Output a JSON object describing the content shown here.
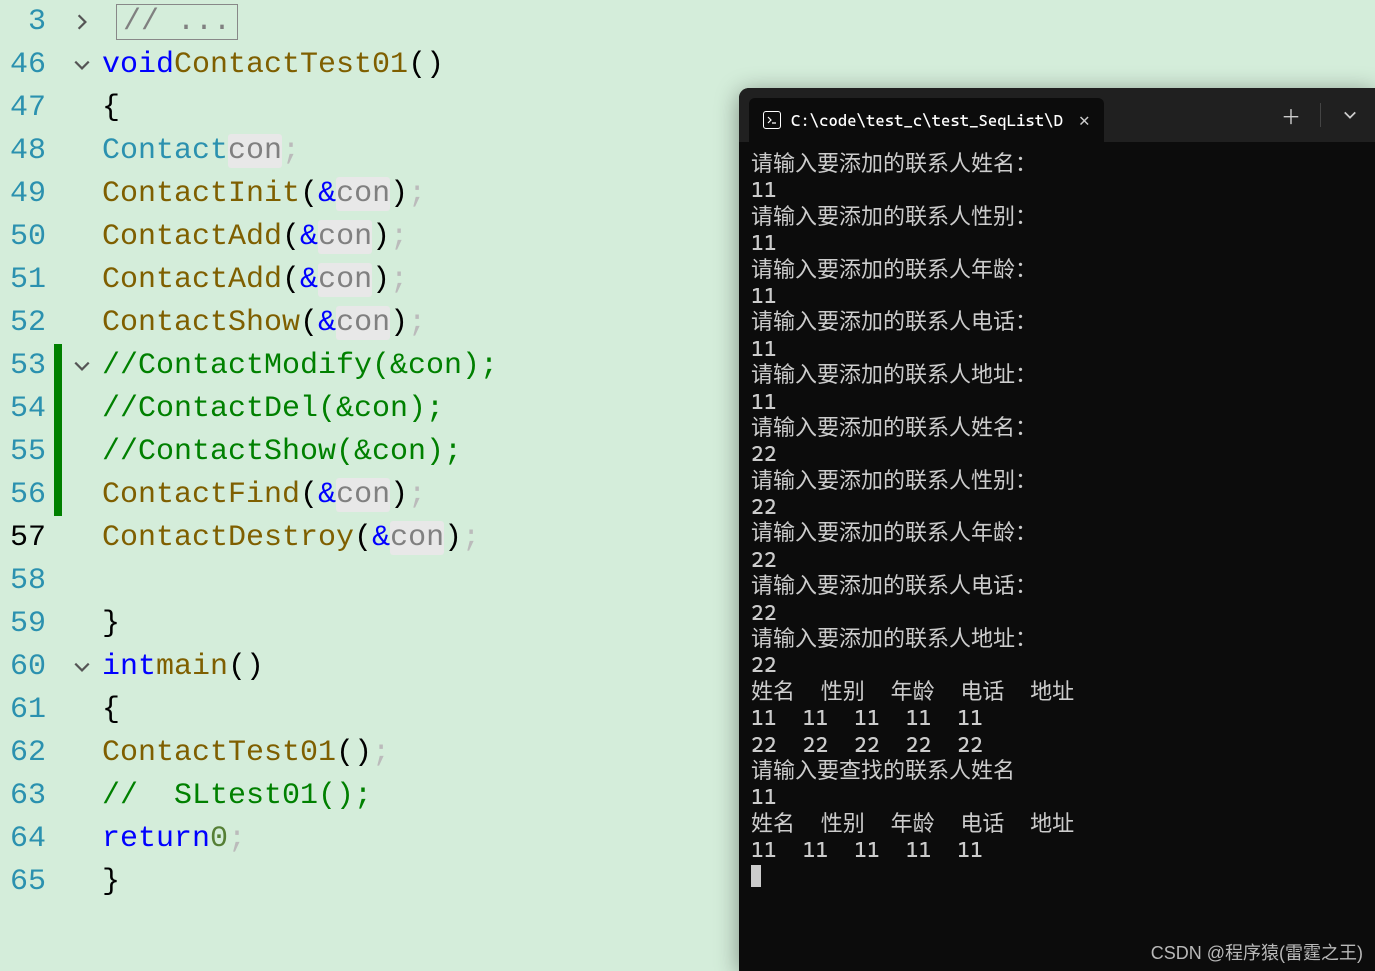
{
  "editor": {
    "lines": {
      "3": "3",
      "46": "46",
      "47": "47",
      "48": "48",
      "49": "49",
      "50": "50",
      "51": "51",
      "52": "52",
      "53": "53",
      "54": "54",
      "55": "55",
      "56": "56",
      "57": "57",
      "58": "58",
      "59": "59",
      "60": "60",
      "61": "61",
      "62": "62",
      "63": "63",
      "64": "64",
      "65": "65"
    },
    "folded_placeholder": "// ...",
    "l46": {
      "kw": "void",
      "func": "ContactTest01",
      "paren": "()"
    },
    "l47": {
      "brace": "{"
    },
    "l48": {
      "type": "Contact",
      "var": "con",
      "semi": ";"
    },
    "l49": {
      "fn": "ContactInit",
      "lp": "(",
      "amp": "&",
      "var": "con",
      "rp": ")",
      "semi": ";"
    },
    "l50": {
      "fn": "ContactAdd",
      "lp": "(",
      "amp": "&",
      "var": "con",
      "rp": ")",
      "semi": ";"
    },
    "l51": {
      "fn": "ContactAdd",
      "lp": "(",
      "amp": "&",
      "var": "con",
      "rp": ")",
      "semi": ";"
    },
    "l52": {
      "fn": "ContactShow",
      "lp": "(",
      "amp": "&",
      "var": "con",
      "rp": ")",
      "semi": ";"
    },
    "l53": {
      "comment": "//ContactModify(&con);"
    },
    "l54": {
      "comment": "//ContactDel(&con);"
    },
    "l55": {
      "comment": "//ContactShow(&con);"
    },
    "l56": {
      "fn": "ContactFind",
      "lp": "(",
      "amp": "&",
      "var": "con",
      "rp": ")",
      "semi": ";"
    },
    "l57": {
      "fn": "ContactDestroy",
      "lp": "(",
      "amp": "&",
      "var": "con",
      "rp": ")",
      "semi": ";"
    },
    "l59": {
      "brace": "}"
    },
    "l60": {
      "kw": "int",
      "func": "main",
      "paren": "()"
    },
    "l61": {
      "brace": "{"
    },
    "l62": {
      "fn": "ContactTest01",
      "lp": "(",
      "rp": ")",
      "semi": ";"
    },
    "l63": {
      "slashes": "//",
      "rest": "  SLtest01();"
    },
    "l64": {
      "kw": "return",
      "num": "0",
      "semi": ";"
    },
    "l65": {
      "brace": "}"
    }
  },
  "terminal": {
    "tab_title": "C:\\code\\test_c\\test_SeqList\\D",
    "output": "请输入要添加的联系人姓名：\n11\n请输入要添加的联系人性别：\n11\n请输入要添加的联系人年龄：\n11\n请输入要添加的联系人电话：\n11\n请输入要添加的联系人地址：\n11\n请输入要添加的联系人姓名：\n22\n请输入要添加的联系人性别：\n22\n请输入要添加的联系人年龄：\n22\n请输入要添加的联系人电话：\n22\n请输入要添加的联系人地址：\n22\n姓名  性别  年龄  电话  地址\n11  11  11  11  11\n22  22  22  22  22\n请输入要查找的联系人姓名\n11\n姓名  性别  年龄  电话  地址\n11  11  11  11  11"
  },
  "watermark": "CSDN @程序猿(雷霆之王)"
}
